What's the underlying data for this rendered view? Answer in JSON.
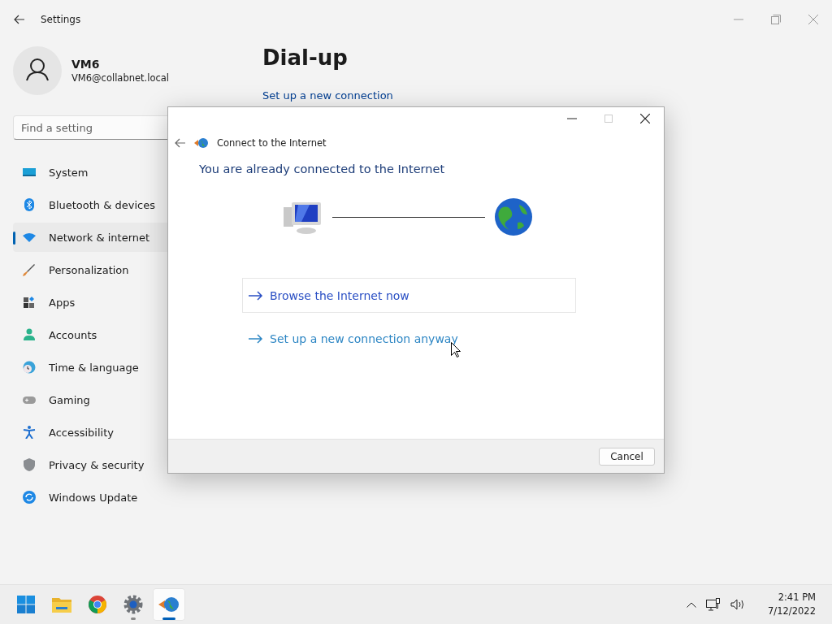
{
  "settings_window": {
    "title": "Settings",
    "user": {
      "name": "VM6",
      "email": "VM6@collabnet.local"
    },
    "search": {
      "placeholder": "Find a setting"
    },
    "sidebar": {
      "items": [
        {
          "label": "System",
          "selected": false
        },
        {
          "label": "Bluetooth & devices",
          "selected": false
        },
        {
          "label": "Network & internet",
          "selected": true
        },
        {
          "label": "Personalization",
          "selected": false
        },
        {
          "label": "Apps",
          "selected": false
        },
        {
          "label": "Accounts",
          "selected": false
        },
        {
          "label": "Time & language",
          "selected": false
        },
        {
          "label": "Gaming",
          "selected": false
        },
        {
          "label": "Accessibility",
          "selected": false
        },
        {
          "label": "Privacy & security",
          "selected": false
        },
        {
          "label": "Windows Update",
          "selected": false
        }
      ]
    },
    "page": {
      "title": "Dial-up",
      "link": "Set up a new connection"
    }
  },
  "dialog": {
    "title": "Connect to the Internet",
    "heading": "You are already connected to the Internet",
    "options": [
      {
        "label": "Browse the Internet now",
        "highlighted": true
      },
      {
        "label": "Set up a new connection anyway",
        "highlighted": false
      }
    ],
    "buttons": [
      "Cancel"
    ]
  },
  "taskbar": {
    "apps": [
      {
        "active": false,
        "running": false
      },
      {
        "active": false,
        "running": false
      },
      {
        "active": false,
        "running": false
      },
      {
        "active": false,
        "running": true
      },
      {
        "active": true,
        "running": true
      }
    ],
    "time": "2:41 PM",
    "date": "7/12/2022"
  }
}
